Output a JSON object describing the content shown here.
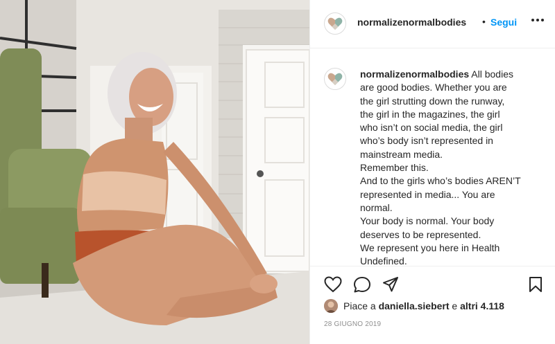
{
  "post": {
    "username": "normalizenormalbodies",
    "follow_label": "Segui",
    "separator": "•",
    "caption_lines": [
      "All bodies",
      "are good bodies. Whether you are",
      "the girl strutting down the runway,",
      "the girl in the magazines, the girl",
      "who isn’t on social media, the girl",
      "who’s body isn’t represented in",
      "mainstream media.",
      "Remember this.",
      "And to the girls who’s bodies AREN’T",
      "represented in media... You are",
      "normal.",
      "Your body is normal. Your body",
      "deserves to be represented.",
      "We represent you here in Health",
      "Undefined."
    ],
    "likes": {
      "prefix": "Piace a",
      "liker": "daniella.siebert",
      "connector": "e",
      "others": "altri 4.118"
    },
    "date": "28 GIUGNO 2019"
  },
  "icons": {
    "more": "more-options-icon",
    "like": "heart-icon",
    "comment": "comment-icon",
    "share": "share-icon",
    "save": "bookmark-icon",
    "avatar_logo": "heart-logo-icon"
  },
  "colors": {
    "follow": "#0095f6",
    "text": "#262626",
    "muted": "#8e8e8e",
    "divider": "#efefef"
  }
}
